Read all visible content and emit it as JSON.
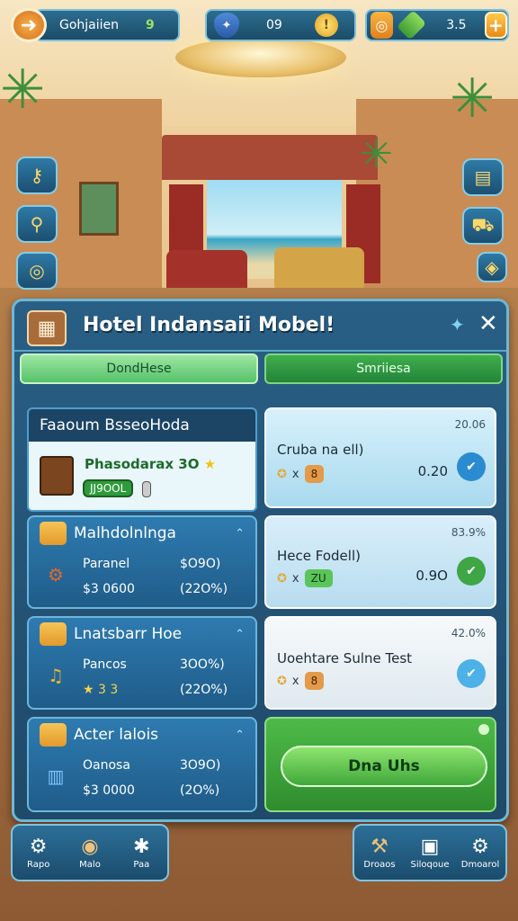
{
  "topbar": {
    "name": "Gohjaiien",
    "level": "9",
    "coins": "09",
    "currency": "3.5",
    "icons": [
      "back-arrow-icon",
      "shield-icon",
      "coin-icon",
      "orange-chest-icon",
      "gem-icon",
      "plus-icon"
    ]
  },
  "side_buttons_left": [
    "key-icon",
    "search-icon",
    "magnifier-icon"
  ],
  "side_buttons_right": [
    "clipboard-icon",
    "truck-icon",
    "badge-icon"
  ],
  "dialog": {
    "title": "Hotel Indansaii Mobel!",
    "tabs": [
      "DondHese",
      "Smriiesa"
    ],
    "left_cards": [
      {
        "header": "Faaoum BsseoHoda",
        "name": "Phasodarax 3O",
        "badge": "JJ9OOL"
      },
      {
        "header": "Malhdolnlnga",
        "r1a": "Paranel",
        "r1b": "$O9O)",
        "r2a": "$3 0600",
        "r2b": "(22O%)"
      },
      {
        "header": "Lnatsbarr Hoe",
        "r1a": "Pancos",
        "r1b": "3OO%)",
        "r2a": "★ 3 3",
        "r2b": "(22O%)"
      },
      {
        "header": "Acter lalois",
        "r1a": "Oanosa",
        "r1b": "3O9O)",
        "r2a": "$3 0000",
        "r2b": "(2O%)"
      }
    ],
    "right_cards": [
      {
        "top": "20.06",
        "name": "Cruba na ell)",
        "chip": "8",
        "price": "0.20"
      },
      {
        "top": "83.9%",
        "name": "Hece Fodell)",
        "chip": "ZU",
        "price": "0.9O"
      },
      {
        "top": "42.0%",
        "name": "Uoehtare Sulne Test",
        "chip": "8",
        "price": ""
      }
    ],
    "ok_label": "Dna Uhs"
  },
  "bottom_left": [
    {
      "label": "Rapo"
    },
    {
      "label": "Malo"
    },
    {
      "label": "Paa"
    }
  ],
  "bottom_right": [
    {
      "label": "Droaos"
    },
    {
      "label": "Siloqoue"
    },
    {
      "label": "Dmoarol"
    }
  ]
}
